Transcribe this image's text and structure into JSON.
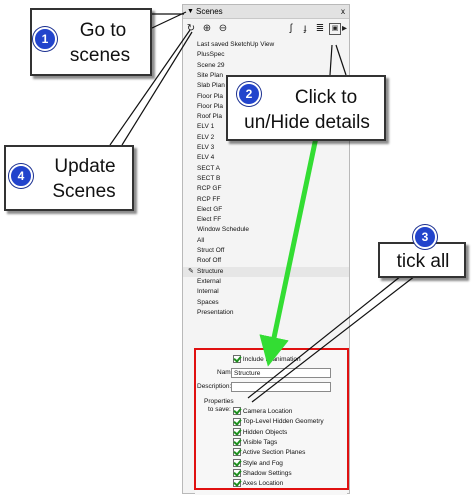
{
  "panel": {
    "title": "Scenes",
    "close": "x"
  },
  "toolbar": {
    "update": "↻",
    "add": "⊕",
    "remove": "⊖",
    "move_up": "ʃ",
    "move_down": "ɟ",
    "view_options": "≣",
    "details": "▣",
    "menu": "▸"
  },
  "scenes": [
    "Last saved SketchUp View",
    "PlusSpec",
    "Scene 29",
    "Site Plan",
    "Slab Plan",
    "Floor Pla",
    "Floor Pla",
    "Roof Pla",
    "ELV 1",
    "ELV 2",
    "ELV 3",
    "ELV 4",
    "SECT A",
    "SECT B",
    "RCP GF",
    "RCP FF",
    "Elect GF",
    "Elect FF",
    "Window Schedule",
    "All",
    "Struct Off",
    "Roof Off",
    "Structure",
    "External",
    "Internal",
    "Spaces",
    "Presentation"
  ],
  "selected_scene": "Structure",
  "details": {
    "include_animation": "Include in animation",
    "name_label": "Name:",
    "name_value": "Structure",
    "description_label": "Description:",
    "description_value": "",
    "properties_label_1": "Properties",
    "properties_label_2": "to save:",
    "properties": [
      "Camera Location",
      "Top-Level Hidden Geometry",
      "Hidden Objects",
      "Visible Tags",
      "Active Section Planes",
      "Style and Fog",
      "Shadow Settings",
      "Axes Location"
    ]
  },
  "callouts": {
    "c1": {
      "num": "1",
      "line1": "Go to",
      "line2": "scenes"
    },
    "c2": {
      "num": "2",
      "line1": "Click to",
      "line2": "un/Hide details"
    },
    "c3": {
      "num": "3",
      "line1": "tick all"
    },
    "c4": {
      "num": "4",
      "line1": "Update",
      "line2": "Scenes"
    }
  },
  "colors": {
    "badge": "#2244cc",
    "arrow": "#33dd33",
    "highlight": "#e01010",
    "check": "#1f8f1f"
  }
}
